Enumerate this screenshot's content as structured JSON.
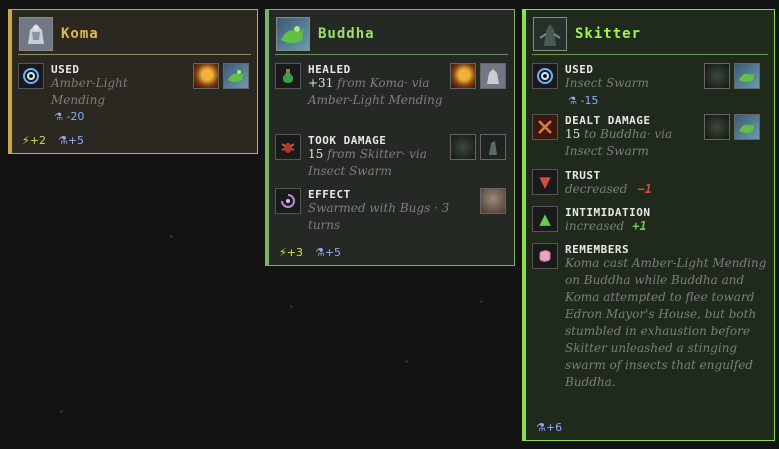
{
  "cards": {
    "koma": {
      "name": "Koma",
      "entries": [
        {
          "title": "USED",
          "text": "Amber-Light Mending",
          "delta": "-20"
        }
      ],
      "footer": {
        "energy": "+2",
        "flask": "+5"
      }
    },
    "buddha": {
      "name": "Buddha",
      "entries": [
        {
          "title": "HEALED",
          "amount": "+31",
          "text": "from Koma· via Amber-Light Mending"
        },
        {
          "title": "TOOK DAMAGE",
          "amount": "15",
          "text": "from Skitter· via Insect Swarm"
        },
        {
          "title": "EFFECT",
          "text": "Swarmed with Bugs · 3 turns"
        }
      ],
      "footer": {
        "energy": "+3",
        "flask": "+5"
      }
    },
    "skitter": {
      "name": "Skitter",
      "entries": [
        {
          "title": "USED",
          "text": "Insect Swarm",
          "delta": "-15"
        },
        {
          "title": "DEALT DAMAGE",
          "amount": "15",
          "text": "to Buddha· via Insect Swarm"
        },
        {
          "title": "TRUST",
          "text": "decreased",
          "change": "−1"
        },
        {
          "title": "INTIMIDATION",
          "text": "increased",
          "change": "+1"
        },
        {
          "title": "REMEMBERS",
          "text": "Koma cast Amber-Light Mending on Buddha while Buddha and Koma attempted to flee toward Edron Mayor's House, but both stumbled in exhaustion before Skitter unleashed a stinging swarm of insects that engulfed Buddha."
        }
      ],
      "footer": {
        "flask": "+6"
      }
    }
  },
  "icons": {
    "used": "swirl-icon",
    "healed": "potion-icon",
    "took_damage": "bug-icon",
    "effect": "vortex-icon",
    "dealt_damage": "crossed-swords-icon",
    "trust": "arrow-down-icon",
    "intimidation": "arrow-up-icon",
    "remembers": "brain-icon",
    "energy": "lightning-icon",
    "flask": "flask-icon"
  },
  "colors": {
    "koma_accent": "#c8a84a",
    "buddha_accent": "#7bb36a",
    "skitter_accent": "#8ce04a",
    "negative": "#d05040",
    "positive": "#6acb4a",
    "flask": "#8fa8ff",
    "energy": "#cde24a"
  }
}
